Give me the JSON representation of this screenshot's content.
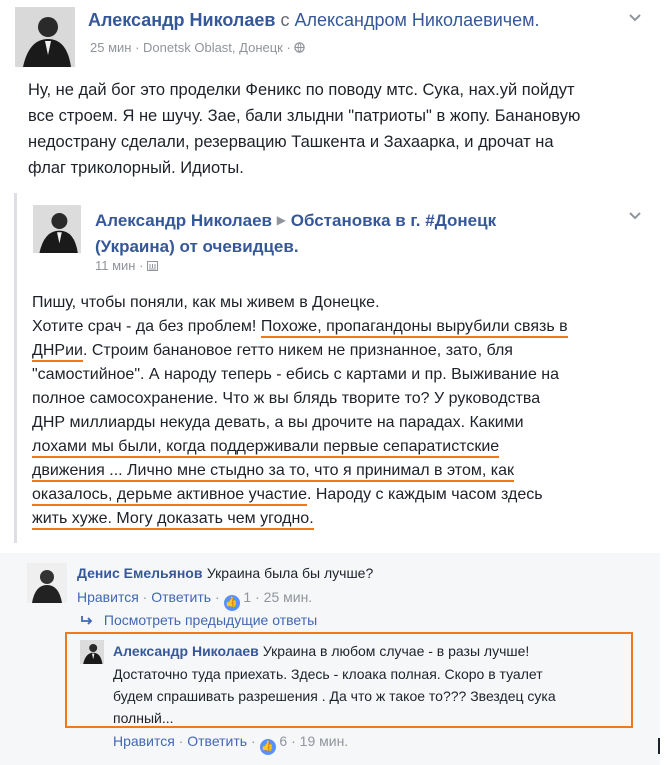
{
  "post": {
    "author": "Александр Николаев",
    "with_text": "с",
    "tagged": "Александром Николаевичем.",
    "meta_time": "25 мин",
    "meta_location": "Donetsk Oblast, Донецк",
    "lines": [
      "Ну, не дай бог это проделки Феникс по поводу мтс. Сука, нах.уй пойдут",
      "все строем. Я не шучу. Зае, бали злыдни \"патриоты\" в жопу. Банановую",
      "недострану сделали, резервацию Ташкента и Захаарка, и дрочат на",
      "флаг триколорный. Идиоты."
    ]
  },
  "shared_post": {
    "author": "Александр Николаев",
    "group_line1": "Обстановка в г. #Донецк",
    "group_line2": "(Украина) от очевидцев.",
    "meta_time": "11 мин",
    "l1": "Пишу, чтобы поняли, как мы живем в Донецке.",
    "l2a": "Хотите срач - да без проблем! ",
    "l2b": "Похоже, пропагандоны вырубили связь в",
    "l3a": "ДНРии",
    "l3b": ". Строим банановое гетто никем не признанное, зато, бля",
    "l4": "\"самостийное\". А народу теперь - ебись с картами и пр. Выживание на",
    "l5": "полное самосохранение. Что ж вы блядь творите то? У руководства",
    "l6": "ДНР миллиарды некуда девать, а вы дрочите на парадах. Какими",
    "l7": "лохами мы были, когда поддерживали первые сепаратистские",
    "l8a": "движения ... ",
    "l8b": "Лично мне стыдно за то, что я принимал в этом, как",
    "l9a": "оказалось, дерьме активное участие",
    "l9b": ". Народу с каждым часом здесь",
    "l10": "жить хуже. Могу доказать чем угодно."
  },
  "comment1": {
    "author": "Денис Емельянов",
    "text": "Украина была бы лучше?",
    "like": "Нравится",
    "reply": "Ответить",
    "likes": "1",
    "time": "25 мин."
  },
  "view_previous": "Посмотреть предыдущие ответы",
  "reply1": {
    "author": "Александр Николаев",
    "lines": [
      "Украина в любом случае - в разы лучше!",
      "Достаточно туда приехать. Здесь - клоака полная. Скоро в туалет",
      "будем спрашивать разрешения . Да что ж такое то??? Звездец сука",
      "полный..."
    ],
    "like": "Нравится",
    "reply": "Ответить",
    "likes": "6",
    "time": "19 мин."
  },
  "separator": "·",
  "icons": [
    "globe-icon",
    "group-icon",
    "chevron-down-icon",
    "arrow-right-icon",
    "reply-arrow-icon",
    "thumbs-up-icon"
  ],
  "colors": {
    "link": "#365899",
    "meta": "#90949c",
    "highlight": "#f07a1a",
    "like": "#5890ff"
  }
}
